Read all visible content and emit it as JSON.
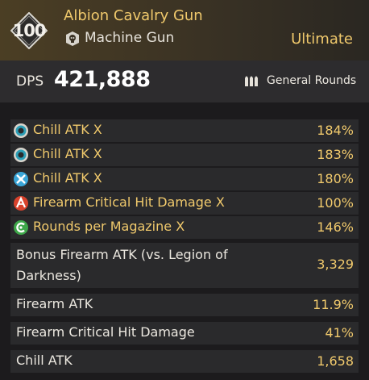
{
  "header": {
    "level": "100",
    "weapon_name": "Albion Cavalry Gun",
    "weapon_type": "Machine Gun",
    "rarity": "Ultimate",
    "type_icon": "shield-skull-icon"
  },
  "dps": {
    "label": "DPS",
    "value": "421,888",
    "ammo_label": "General Rounds",
    "ammo_icon": "bullets-icon"
  },
  "colors": {
    "gold": "#f0c96c",
    "header_bg": "#4b3e24",
    "row_bg": "#2a2a2c",
    "chill_icon": "#33b3c8",
    "crit_icon": "#d8422c",
    "mag_icon": "#3ea84a"
  },
  "attributes": [
    {
      "icon": "chill-ring-icon",
      "label": "Chill ATK X",
      "value": "184%"
    },
    {
      "icon": "chill-ring-icon",
      "label": "Chill ATK X",
      "value": "183%"
    },
    {
      "icon": "chill-cross-icon",
      "label": "Chill ATK X",
      "value": "180%"
    },
    {
      "icon": "crit-damage-icon",
      "label": "Firearm Critical Hit Damage X",
      "value": "100%"
    },
    {
      "icon": "magazine-icon",
      "label": "Rounds per Magazine X",
      "value": "146%"
    }
  ],
  "bonus_stats": [
    {
      "label": "Bonus Firearm ATK (vs. Legion of Darkness)",
      "value": "3,329"
    },
    {
      "label": "Firearm ATK",
      "value": "11.9%"
    },
    {
      "label": "Firearm Critical Hit Damage",
      "value": "41%"
    },
    {
      "label": "Chill ATK",
      "value": "1,658"
    }
  ]
}
